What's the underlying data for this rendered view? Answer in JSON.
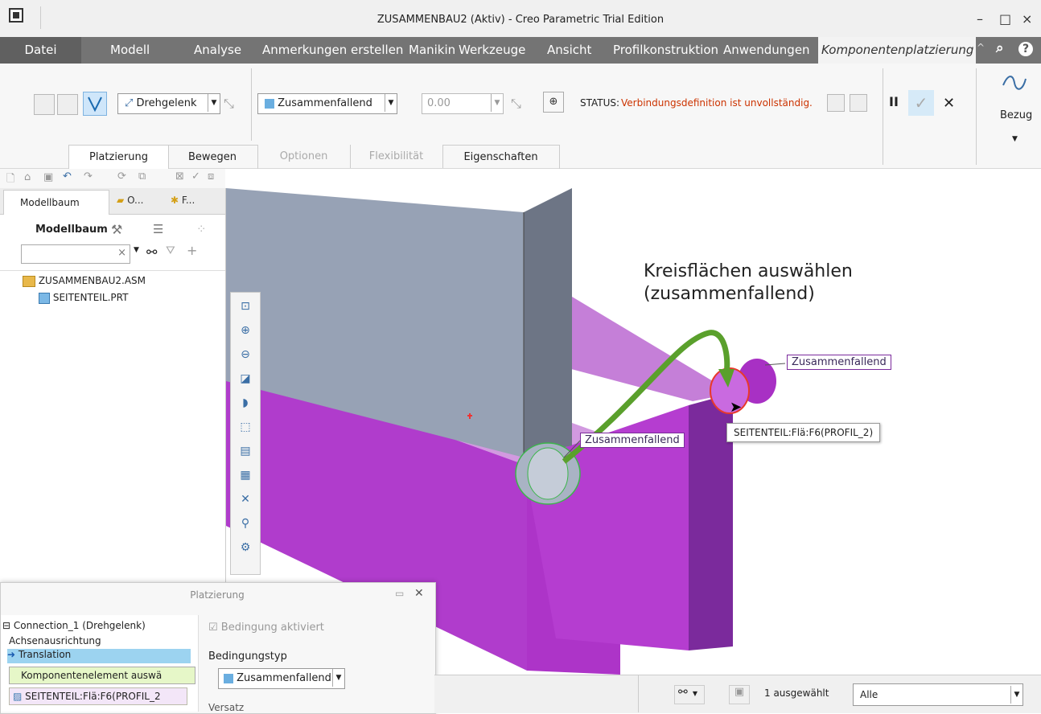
{
  "window": {
    "title": "ZUSAMMENBAU2 (Aktiv) - Creo Parametric Trial Edition",
    "min": "–",
    "max": "□",
    "close": "×"
  },
  "tabs": [
    "Datei",
    "Modell",
    "Analyse",
    "Anmerkungen erstellen",
    "Manikin",
    "Werkzeuge",
    "Ansicht",
    "Profilkonstruktion",
    "Anwendungen",
    "Komponentenplatzierung"
  ],
  "ribbon": {
    "joint_type": "Drehgelenk",
    "constraint_type": "Zusammenfallend",
    "offset_value": "0.00",
    "status_label": "STATUS:",
    "status_message": "Verbindungsdefinition ist unvollständig.",
    "bezug_label": "Bezug",
    "status_color": "#cc3300"
  },
  "subtabs": [
    "Platzierung",
    "Bewegen",
    "Optionen",
    "Flexibilität",
    "Eigenschaften"
  ],
  "modeltree": {
    "tabs": [
      "Modellbaum",
      "O...",
      "F..."
    ],
    "header": "Modellbaum",
    "items": [
      "ZUSAMMENBAU2.ASM",
      "SEITENTEIL.PRT"
    ]
  },
  "viewport": {
    "annotation_line1": "Kreisflächen auswählen",
    "annotation_line2": "(zusammenfallend)",
    "label_top": "Zusammenfallend",
    "label_bottom": "Zusammenfallend",
    "tooltip": "SEITENTEIL:Flä:F6(PROFIL_2)",
    "part_color": "#b03ccc",
    "arrow_color": "#5aa02c"
  },
  "dialog": {
    "title": "Platzierung",
    "tree": [
      "Connection_1 (Drehgelenk)",
      "Achsenausrichtung",
      "Translation",
      "Komponentenelement auswä",
      "SEITENTEIL:Flä:F6(PROFIL_2"
    ],
    "checkbox_label": "Bedingung aktiviert",
    "constraint_type_label": "Bedingungstyp",
    "constraint_type": "Zusammenfallend",
    "offset_label": "Versatz"
  },
  "statusbar": {
    "selected": "1 ausgewählt",
    "filter": "Alle"
  }
}
